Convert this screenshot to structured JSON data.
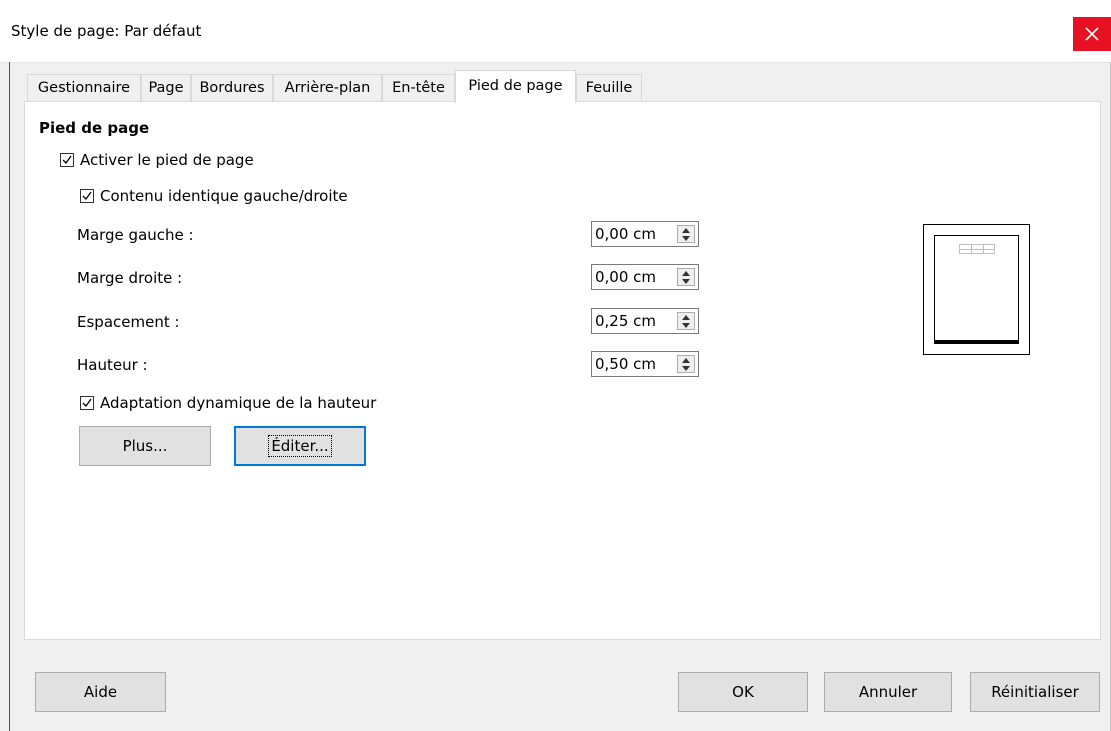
{
  "window": {
    "title": "Style de page: Par défaut",
    "close_icon": "close-icon"
  },
  "tabs": [
    {
      "label": "Gestionnaire"
    },
    {
      "label": "Page"
    },
    {
      "label": "Bordures"
    },
    {
      "label": "Arrière-plan"
    },
    {
      "label": "En-tête"
    },
    {
      "label": "Pied de page",
      "active": true
    },
    {
      "label": "Feuille"
    }
  ],
  "section": {
    "title": "Pied de page",
    "activate_footer": {
      "label": "Activer le pied de page",
      "checked": true
    },
    "same_content": {
      "label": "Contenu identique gauche/droite",
      "checked": true
    },
    "fields": [
      {
        "label": "Marge gauche :",
        "value": "0,00 cm"
      },
      {
        "label": "Marge droite :",
        "value": "0,00 cm"
      },
      {
        "label": "Espacement :",
        "value": "0,25 cm"
      },
      {
        "label": "Hauteur :",
        "value": "0,50 cm"
      }
    ],
    "autofit": {
      "label": "Adaptation dynamique de la hauteur",
      "checked": true
    },
    "more_button": "Plus...",
    "edit_button": "Éditer..."
  },
  "footer_buttons": {
    "help": "Aide",
    "ok": "OK",
    "cancel": "Annuler",
    "reset": "Réinitialiser"
  },
  "colors": {
    "close_bg": "#e81123",
    "focus_border": "#0078d7"
  }
}
